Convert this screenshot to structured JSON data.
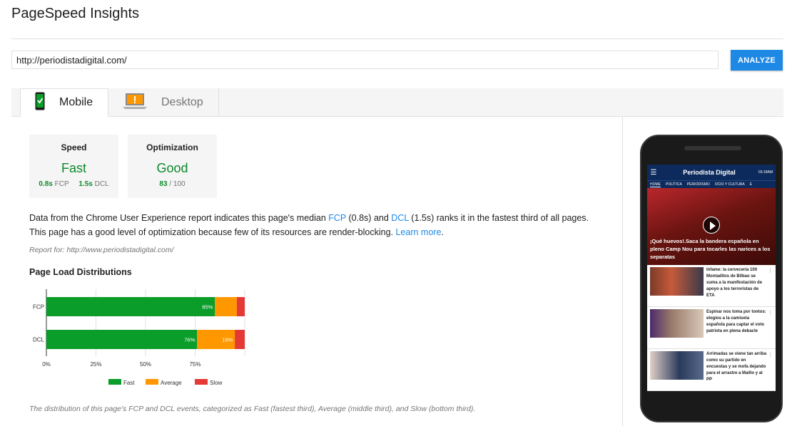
{
  "app": {
    "title": "PageSpeed Insights"
  },
  "search": {
    "url": "http://periodistadigital.com/",
    "analyze_label": "ANALYZE"
  },
  "tabs": [
    {
      "label": "Mobile",
      "active": true,
      "icon": "mobile-check-icon"
    },
    {
      "label": "Desktop",
      "active": false,
      "icon": "desktop-warning-icon"
    }
  ],
  "cards": {
    "speed": {
      "label": "Speed",
      "value": "Fast",
      "fcp_value": "0.8s",
      "fcp_label": "FCP",
      "dcl_value": "1.5s",
      "dcl_label": "DCL"
    },
    "optimization": {
      "label": "Optimization",
      "value": "Good",
      "score": "83",
      "max": "/ 100"
    }
  },
  "description": {
    "part1": "Data from the Chrome User Experience report indicates this page's median ",
    "fcp_link": "FCP",
    "part2": " (0.8s) and ",
    "dcl_link": "DCL",
    "part3": " (1.5s) ranks it in the fastest third of all pages.",
    "line2": "This page has a good level of optimization because few of its resources are render-blocking. ",
    "learn_more": "Learn more",
    "end": "."
  },
  "report_for": "Report for: http://www.periodistadigital.com/",
  "distribution": {
    "title": "Page Load Distributions",
    "footnote": "The distribution of this page's FCP and DCL events, categorized as Fast (fastest third), Average (middle third), and Slow (bottom third)."
  },
  "chart_data": {
    "type": "bar",
    "orientation": "horizontal",
    "stacked": true,
    "categories": [
      "FCP",
      "DCL"
    ],
    "series": [
      {
        "name": "Fast",
        "color": "#0b9d2a",
        "values": [
          85,
          76
        ],
        "labels": [
          "85%",
          "76%"
        ]
      },
      {
        "name": "Average",
        "color": "#ff9800",
        "values": [
          11,
          19
        ],
        "labels": [
          "",
          "19%"
        ]
      },
      {
        "name": "Slow",
        "color": "#e53935",
        "values": [
          4,
          5
        ],
        "labels": [
          "",
          ""
        ]
      }
    ],
    "xticks": [
      "0%",
      "25%",
      "50%",
      "75%"
    ],
    "xlim": [
      0,
      100
    ],
    "grid": true,
    "legend": "bottom"
  },
  "phone": {
    "brand": "Periodista Digital",
    "time": "03:18AM",
    "nav": [
      "HOME",
      "POLÍTICA",
      "PERIODISMO",
      "OCIO Y CULTURA",
      "E"
    ],
    "hero_caption": "¡Qué huevos!.Saca la bandera española en pleno Camp Nou para tocarles las narices a los separatas",
    "items": [
      "Infame: la cervecería 100 Montaditos de Bilbao se suma a la manifestación de apoyo a los terroristas de ETA",
      "Espinar nos toma por tontos: elogios a la camiseta española para captar el voto patriota en plena debacle",
      "Arrimadas se viene tan arriba como su partido en encuestas y se mofa dejando para el arrastre a Maíllo y al PP"
    ]
  }
}
